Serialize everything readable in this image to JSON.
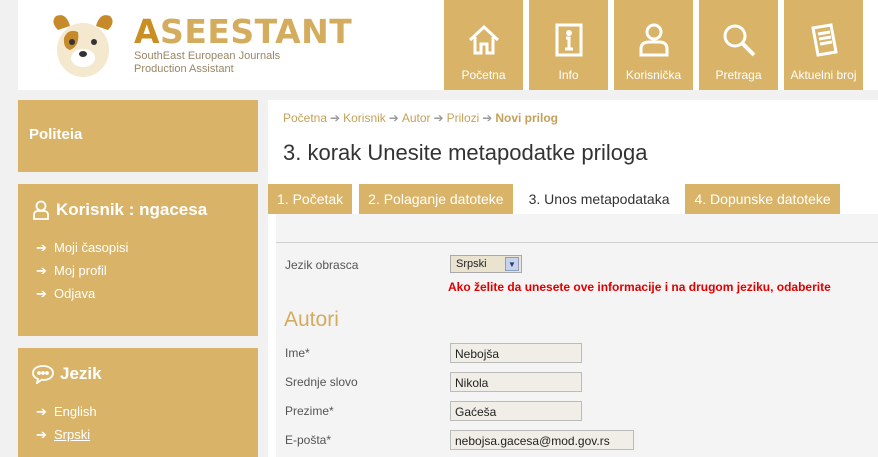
{
  "brand": {
    "name_first": "A",
    "name_rest": "SEESTANT",
    "subtitle_line1": "SouthEast European Journals",
    "subtitle_line2": "Production Assistant"
  },
  "nav": [
    {
      "label": "Početna",
      "icon": "home-icon"
    },
    {
      "label": "Info",
      "icon": "info-icon"
    },
    {
      "label": "Korisnička",
      "icon": "user-icon"
    },
    {
      "label": "Pretraga",
      "icon": "search-icon"
    },
    {
      "label": "Aktuelni broj",
      "icon": "document-icon"
    }
  ],
  "sidebar": {
    "journal": "Politeia",
    "user_title": "Korisnik : ngacesa",
    "user_links": [
      "Moji časopisi",
      "Moj profil",
      "Odjava"
    ],
    "lang_title": "Jezik",
    "lang_links": [
      "English",
      "Srpski"
    ]
  },
  "breadcrumb": [
    "Početna",
    "Korisnik",
    "Autor",
    "Prilozi",
    "Novi prilog"
  ],
  "page_title": "3. korak Unesite metapodatke priloga",
  "tabs": [
    "1. Početak",
    "2. Polaganje datoteke",
    "3. Unos metapodataka",
    "4. Dopunske datoteke"
  ],
  "form": {
    "lang_label": "Jezik obrasca",
    "lang_value": "Srpski",
    "warning": "Ako želite da unesete ove informacije i na drugom jeziku, odaberite",
    "section": "Autori",
    "fields": [
      {
        "label": "Ime*",
        "value": "Nebojša"
      },
      {
        "label": "Srednje slovo",
        "value": "Nikola"
      },
      {
        "label": "Prezime*",
        "value": "Gaćeša"
      },
      {
        "label": "E-pošta*",
        "value": "nebojsa.gacesa@mod.gov.rs"
      }
    ]
  },
  "colors": {
    "accent": "#d9b468",
    "warning": "#e00000"
  }
}
